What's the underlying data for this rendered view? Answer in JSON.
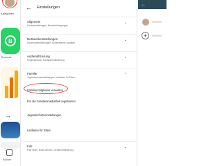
{
  "left_pane": {
    "kategorien_label": "Kategorien",
    "business_label": "Business",
    "nav_label": "Bücher",
    "icons": [
      "avatar",
      "whatsapp-business-icon",
      "chart-app-icon",
      "arrow-right-icon",
      "books-icon"
    ]
  },
  "settings": {
    "title": "Einstellungen",
    "sections": [
      {
        "title": "Allgemein",
        "subtitle": "Kontoeinstellungen, Benachrichtigungen"
      },
      {
        "title": "Netzwerkeinstellungen",
        "subtitle": "Downloadeinstellungen, Automatische Updates"
      },
      {
        "title": "Authentifizierung",
        "subtitle": "Fingerabdruck, Kaufauthentifizierung"
      },
      {
        "title": "Familie",
        "subtitle": "Jugendschutzeinstellungen, Leitfaden für Eltern"
      }
    ],
    "family_items": [
      "Familienmitglieder verwalten",
      "Für die Familienmediathek registrieren",
      "Jugendschutzeinstellungen",
      "Leitfaden für Eltern"
    ],
    "info": {
      "title": "Info",
      "subtitle": "Play Store, Build-Version, Gerätezertifizierung"
    }
  },
  "colors": {
    "accent_red": "#e53935",
    "whatsapp_green": "#25d366",
    "right_bar": "#2b4a5a"
  }
}
